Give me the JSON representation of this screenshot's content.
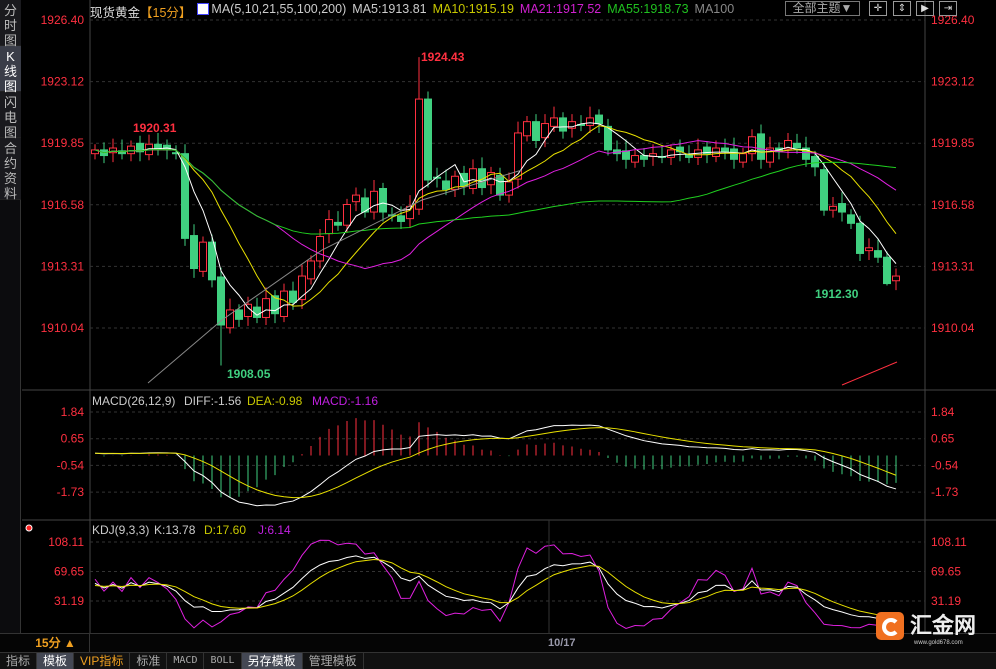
{
  "sidebar": {
    "items": [
      {
        "label": "分时图",
        "active": false
      },
      {
        "label": "K线图",
        "active": true
      },
      {
        "label": "闪电图",
        "active": false
      },
      {
        "label": "合约资料",
        "active": false
      }
    ]
  },
  "header": {
    "symbol": "现货黄金",
    "period": "【15分】",
    "ma_title": "MA(5,10,21,55,100,200)",
    "ma5": "MA5:1913.81",
    "ma10": "MA10:1915.19",
    "ma21": "MA21:1917.52",
    "ma55": "MA55:1918.73",
    "ma100": "MA100",
    "theme_button": "全部主题▼"
  },
  "colors": {
    "up": "#ff3040",
    "down": "#40d080",
    "ma5": "#ffffff",
    "ma10": "#e8e000",
    "ma21": "#e020e0",
    "ma55": "#20d020",
    "ma100": "#888888",
    "axis": "#ff3040"
  },
  "main_axis": {
    "labels": [
      "1926.40",
      "1923.12",
      "1919.85",
      "1916.58",
      "1913.31",
      "1910.04"
    ]
  },
  "annotations": {
    "high": "1924.43",
    "low": "1908.05",
    "left_high": "1920.31",
    "last_low": "1912.30"
  },
  "macd": {
    "title": "MACD(26,12,9)",
    "diff": "DIFF:-1.56",
    "dea": "DEA:-0.98",
    "macd": "MACD:-1.16",
    "axis": [
      "1.84",
      "0.65",
      "-0.54",
      "-1.73"
    ]
  },
  "kdj": {
    "title": "KDJ(9,3,3)",
    "k": "K:13.78",
    "d": "D:17.60",
    "j": "J:6.14",
    "axis": [
      "108.11",
      "69.65",
      "31.19"
    ]
  },
  "timebar": {
    "period": "15分 ▲",
    "date": "10/17"
  },
  "tabs": [
    "指标",
    "模板",
    "VIP指标",
    "标准",
    "MACD",
    "BOLL",
    "另存模板",
    "管理模板"
  ],
  "logo": {
    "name": "汇金网",
    "url": "www.gold678.com"
  },
  "chart_data": {
    "type": "candlestick",
    "closes": [
      1919.5,
      1919.2,
      1919.6,
      1919.3,
      1919.7,
      1919.4,
      1919.8,
      1919.6,
      1919.5,
      1919.3,
      1914.8,
      1913.2,
      1914.6,
      1912.6,
      1910.2,
      1911.0,
      1910.5,
      1911.3,
      1910.6,
      1911.6,
      1910.8,
      1912.0,
      1911.4,
      1912.8,
      1913.6,
      1914.9,
      1915.8,
      1915.5,
      1916.6,
      1917.1,
      1916.2,
      1917.3,
      1916.2,
      1916.0,
      1915.7,
      1916.5,
      1922.2,
      1917.9,
      1918.0,
      1917.4,
      1918.1,
      1917.6,
      1918.5,
      1917.5,
      1918.3,
      1917.1,
      1917.8,
      1920.4,
      1921.0,
      1920.0,
      1920.9,
      1921.2,
      1920.5,
      1921.0,
      1920.8,
      1921.2,
      1920.9,
      1919.5,
      1919.3,
      1919.0,
      1919.2,
      1919.0,
      1919.3,
      1919.1,
      1919.5,
      1919.4,
      1919.1,
      1919.5,
      1919.3,
      1919.6,
      1919.4,
      1919.0,
      1919.3,
      1920.2,
      1919.0,
      1919.6,
      1919.4,
      1920.0,
      1919.6,
      1919.0,
      1918.6,
      1916.3,
      1916.5,
      1916.2,
      1915.6,
      1914.0,
      1914.3,
      1913.8,
      1912.4,
      1912.8
    ],
    "ylim": [
      1907.0,
      1927.0
    ]
  }
}
